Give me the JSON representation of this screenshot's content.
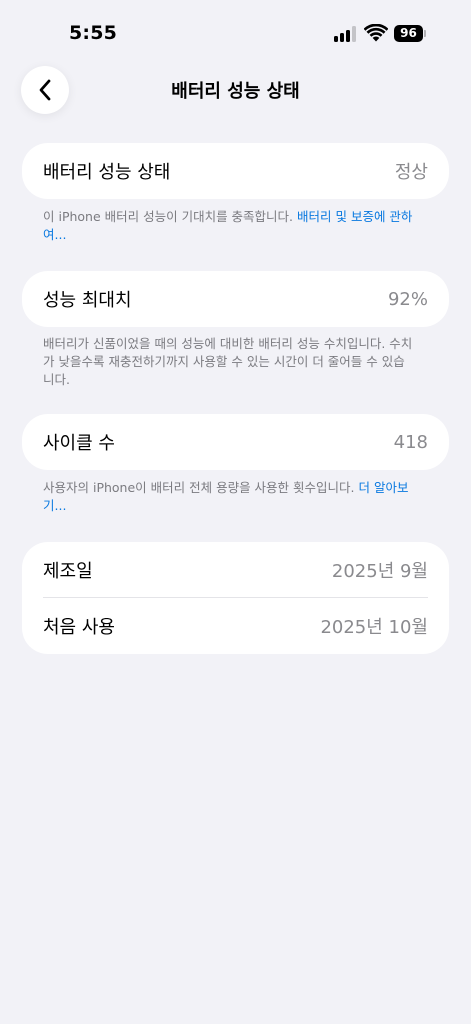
{
  "status_bar": {
    "time": "5:55",
    "battery_level": "96",
    "signal_bars_active": 3,
    "signal_bars_total": 4
  },
  "nav": {
    "title": "배터리 성능 상태",
    "back_icon": "chevron-left-icon"
  },
  "health_card": {
    "label": "배터리 성능 상태",
    "value": "정상"
  },
  "health_note": {
    "text": "이 iPhone 배터리 성능이 기대치를 충족합니다. ",
    "link": "배터리 및 보증에 관하여..."
  },
  "max_capacity_card": {
    "label": "성능 최대치",
    "value": "92%"
  },
  "max_capacity_note": {
    "text": "배터리가 신품이었을 때의 성능에 대비한 배터리 성능 수치입니다. 수치가 낮을수록 재충전하기까지 사용할 수 있는 시간이 더 줄어들 수 있습니다."
  },
  "cycle_card": {
    "label": "사이클 수",
    "value": "418"
  },
  "cycle_note": {
    "text": "사용자의 iPhone이 배터리 전체 용량을 사용한 횟수입니다. ",
    "link": "더 알아보기..."
  },
  "dates_card": {
    "manufacture_label": "제조일",
    "manufacture_value": "2025년 9월",
    "first_use_label": "처음 사용",
    "first_use_value": "2025년 10월"
  },
  "colors": {
    "background": "#f2f2f7",
    "card": "#ffffff",
    "link": "#0a79e0",
    "secondary_text": "#8a8a8e"
  }
}
